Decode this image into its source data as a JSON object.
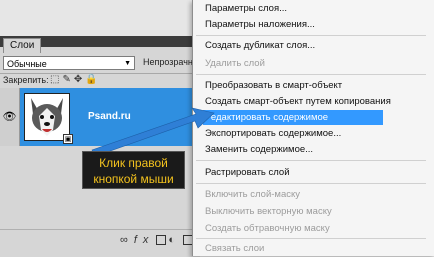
{
  "layers_panel": {
    "tab_label": "Слои",
    "blend_mode": "Обычные",
    "opacity_label": "Непрозрачн",
    "lock_label": "Закрепить:",
    "layer": {
      "name": "Psand.ru",
      "eye_icon": "eye-icon",
      "badge": "smart-object-icon"
    },
    "bottom_icons": [
      "link-icon",
      "fx-icon",
      "mask-icon",
      "adjustment-icon",
      "folder-icon"
    ]
  },
  "callout": {
    "line1": "Клик правой",
    "line2": "кнопкой мыши"
  },
  "context_menu": {
    "items": [
      {
        "label": "Параметры слоя...",
        "enabled": true
      },
      {
        "label": "Параметры наложения...",
        "enabled": true
      },
      {
        "label": "Создать дубликат слоя...",
        "enabled": true
      },
      {
        "label": "Удалить слой",
        "enabled": false
      },
      {
        "label": "Преобразовать в смарт-объект",
        "enabled": true
      },
      {
        "label": "Создать смарт-объект путем копирования",
        "enabled": true
      },
      {
        "label": "Редактировать содержимое",
        "enabled": true,
        "selected": true
      },
      {
        "label": "Экспортировать содержимое...",
        "enabled": true
      },
      {
        "label": "Заменить содержимое...",
        "enabled": true
      },
      {
        "label": "Растрировать слой",
        "enabled": true
      },
      {
        "label": "Включить слой-маску",
        "enabled": false
      },
      {
        "label": "Выключить векторную маску",
        "enabled": false
      },
      {
        "label": "Создать обтравочную маску",
        "enabled": false
      },
      {
        "label": "Связать слои",
        "enabled": false
      }
    ]
  },
  "colors": {
    "highlight": "#3399ff",
    "layer_selected": "#2f8fe0",
    "callout_text": "#f3c21e",
    "arrow": "#2f7fd6"
  }
}
